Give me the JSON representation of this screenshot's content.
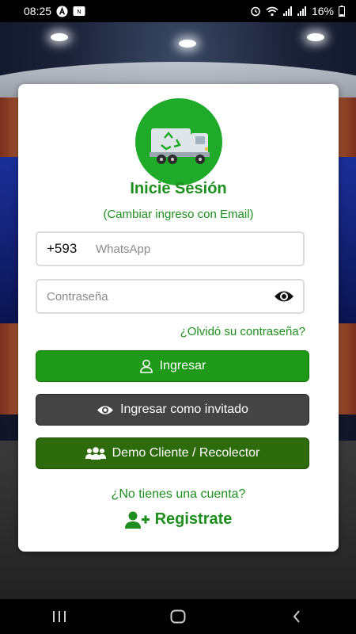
{
  "status_bar": {
    "time": "08:25",
    "battery": "16%",
    "left_icons": [
      "app-a-icon",
      "notification-icon"
    ],
    "right_icons": [
      "alarm-icon",
      "wifi-icon",
      "signal-icon",
      "signal-icon",
      "battery-icon"
    ]
  },
  "login": {
    "title": "Inicie Sesión",
    "switch_email": "(Cambiar ingreso con Email)",
    "phone_prefix": "+593",
    "phone_placeholder": "WhatsApp",
    "password_placeholder": "Contraseña",
    "forgot_password": "¿Olvidó su contraseña?",
    "login_button": "Ingresar",
    "guest_button": "Ingresar como invitado",
    "demo_button": "Demo Cliente / Recolector",
    "no_account": "¿No tienes una cuenta?",
    "register": "Registrate"
  },
  "colors": {
    "primary_green": "#1f9a18",
    "text_green": "#1e8f1e",
    "guest_gray": "#444444",
    "demo_green": "#2e6b0c"
  },
  "nav_bar": {
    "icons": [
      "recent-apps-icon",
      "home-icon",
      "back-icon"
    ]
  }
}
